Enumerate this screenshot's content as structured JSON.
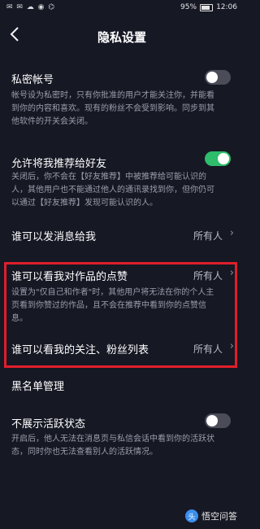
{
  "status": {
    "left_icons": "✉ ✉ ☁ ◉ ⌬",
    "battery_pct": "95%",
    "time": "12:06"
  },
  "nav": {
    "back_icon": "chevron-left-icon",
    "title": "隐私设置"
  },
  "items": [
    {
      "title": "私密帐号",
      "desc": "帐号设为私密时，只有你批准的用户才能关注你，并能看到你的内容和喜欢。现有的粉丝不会受到影响。同步到其他软件的开关会关闭。",
      "toggle": false
    },
    {
      "title": "允许将我推荐给好友",
      "desc": "关闭后，你不会在【好友推荐】中被推荐给可能认识的人，其他用户也不能通过他人的通讯录找到你，但你仍可以通过【好友推荐】发现可能认识的人。",
      "toggle": true
    },
    {
      "title": "谁可以发消息给我",
      "value": "所有人"
    },
    {
      "title": "谁可以看我对作品的点赞",
      "value": "所有人",
      "desc": "设置为\"仅自己和作者\"时，其他用户将无法在你的个人主页看到你赞过的作品，且不会在推荐中看到你的点赞信息。"
    },
    {
      "title": "谁可以看我的关注、粉丝列表",
      "value": "所有人"
    },
    {
      "title": "黑名单管理"
    },
    {
      "title": "不展示活跃状态",
      "desc": "开启后，他人无法在消息页与私信会话中看到你的活跃状态，同时你也无法查看别人的活跃情况。",
      "toggle": false
    }
  ],
  "colors": {
    "toggle_on": "#2ebd6b",
    "highlight": "#e01e2b"
  },
  "watermark": {
    "logo": "头",
    "text": "悟空问答"
  }
}
